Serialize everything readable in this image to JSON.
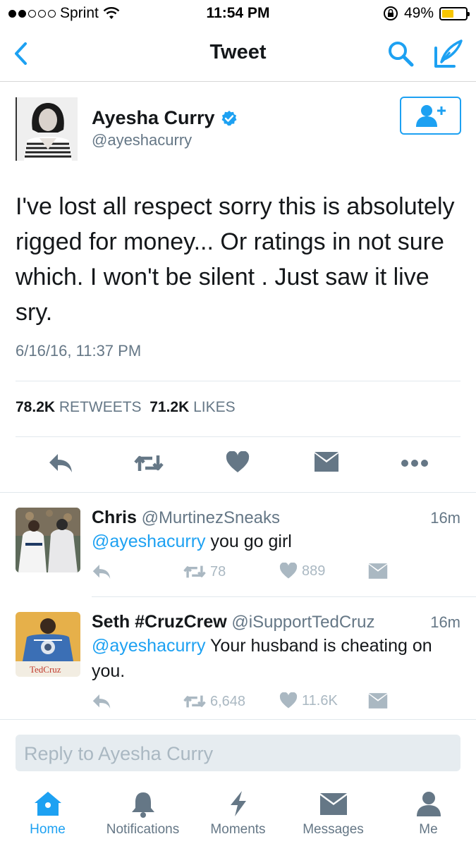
{
  "status_bar": {
    "carrier": "Sprint",
    "time": "11:54 PM",
    "battery": "49%",
    "battery_level": 0.49,
    "signal_bars_filled": 2,
    "signal_bars_total": 5
  },
  "nav": {
    "title": "Tweet",
    "icons": [
      "back-chevron-icon",
      "search-icon",
      "compose-icon"
    ]
  },
  "tweet": {
    "author_name": "Ayesha Curry",
    "author_handle": "@ayeshacurry",
    "verified": true,
    "text": "I've lost all respect sorry this is absolutely rigged for money... Or ratings in not sure which. I won't be silent . Just saw it live sry.",
    "timestamp": "6/16/16, 11:37 PM",
    "retweets_count": "78.2K",
    "retweets_label": "RETWEETS",
    "likes_count": "71.2K",
    "likes_label": "LIKES"
  },
  "replies": [
    {
      "name": "Chris",
      "handle": "@MurtinezSneaks",
      "time": "16m",
      "mention": "@ayeshacurry",
      "text": " you go girl",
      "retweets": "78",
      "likes": "889"
    },
    {
      "name": "Seth #CruzCrew",
      "handle": "@iSupportTedCruz",
      "time": "16m",
      "mention": "@ayeshacurry",
      "text": " Your husband is cheating on you.",
      "retweets": "6,648",
      "likes": "11.6K",
      "avatar_caption": "TedCruz"
    }
  ],
  "reply_box": {
    "placeholder": "Reply to Ayesha Curry"
  },
  "tabs": [
    {
      "label": "Home",
      "icon": "home-icon",
      "active": true
    },
    {
      "label": "Notifications",
      "icon": "bell-icon",
      "active": false
    },
    {
      "label": "Moments",
      "icon": "lightning-icon",
      "active": false
    },
    {
      "label": "Messages",
      "icon": "envelope-icon",
      "active": false
    },
    {
      "label": "Me",
      "icon": "person-icon",
      "active": false
    }
  ],
  "colors": {
    "accent": "#1da1f2",
    "text": "#14171a",
    "secondary": "#657786",
    "muted_icon": "#aab8c2",
    "battery_fill": "#f7c600"
  }
}
